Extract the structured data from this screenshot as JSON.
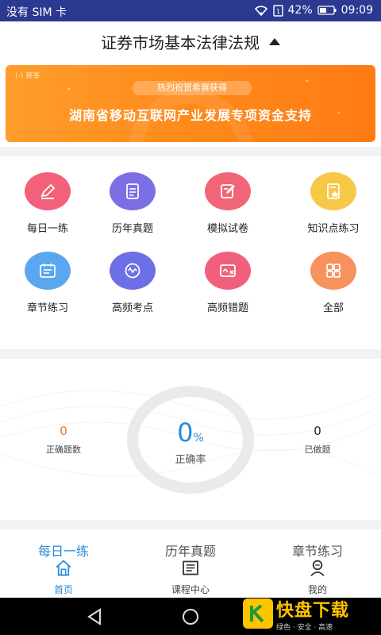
{
  "statusbar": {
    "carrier": "没有 SIM 卡",
    "battery": "42%",
    "time": "09:09"
  },
  "header": {
    "title": "证券市场基本法律法规"
  },
  "banner": {
    "corner": "(-) 赛事",
    "tag": "热烈祝贺希赛获得",
    "headline": "湖南省移动互联网产业发展专项资金支持"
  },
  "grid": {
    "items": [
      {
        "label": "每日一练",
        "icon": "pencil-icon",
        "color": "#f3607a"
      },
      {
        "label": "历年真题",
        "icon": "document-icon",
        "color": "#7b6fe6"
      },
      {
        "label": "模拟试卷",
        "icon": "edit-paper-icon",
        "color": "#f06677"
      },
      {
        "label": "知识点练习",
        "icon": "knowledge-icon",
        "color": "#f7c846"
      },
      {
        "label": "章节练习",
        "icon": "calendar-list-icon",
        "color": "#5aa7f0"
      },
      {
        "label": "高频考点",
        "icon": "wave-chat-icon",
        "color": "#6d6fe6"
      },
      {
        "label": "高频错题",
        "icon": "error-card-icon",
        "color": "#f0607c"
      },
      {
        "label": "全部",
        "icon": "grid-icon",
        "color": "#f7915e"
      }
    ]
  },
  "stats": {
    "correct_count": "0",
    "correct_count_label": "正确题数",
    "rate_value": "0",
    "rate_unit": "%",
    "rate_label": "正确率",
    "done_count": "0",
    "done_label": "已做题"
  },
  "tabbar": {
    "top_labels": [
      "每日一练",
      "历年真题",
      "章节练习"
    ],
    "tabs": [
      {
        "label": "首页",
        "icon": "home-icon",
        "active": true
      },
      {
        "label": "课程中心",
        "icon": "book-icon",
        "active": false
      },
      {
        "label": "我的",
        "icon": "user-icon",
        "active": false
      }
    ]
  },
  "watermark": {
    "brand": "快盘下载",
    "slogan": "绿色 · 安全 · 高速"
  },
  "colors": {
    "statusbar": "#2b3990",
    "accent": "#2a8bd8",
    "banner": "#ff8a1c",
    "correct": "#e8772a"
  }
}
